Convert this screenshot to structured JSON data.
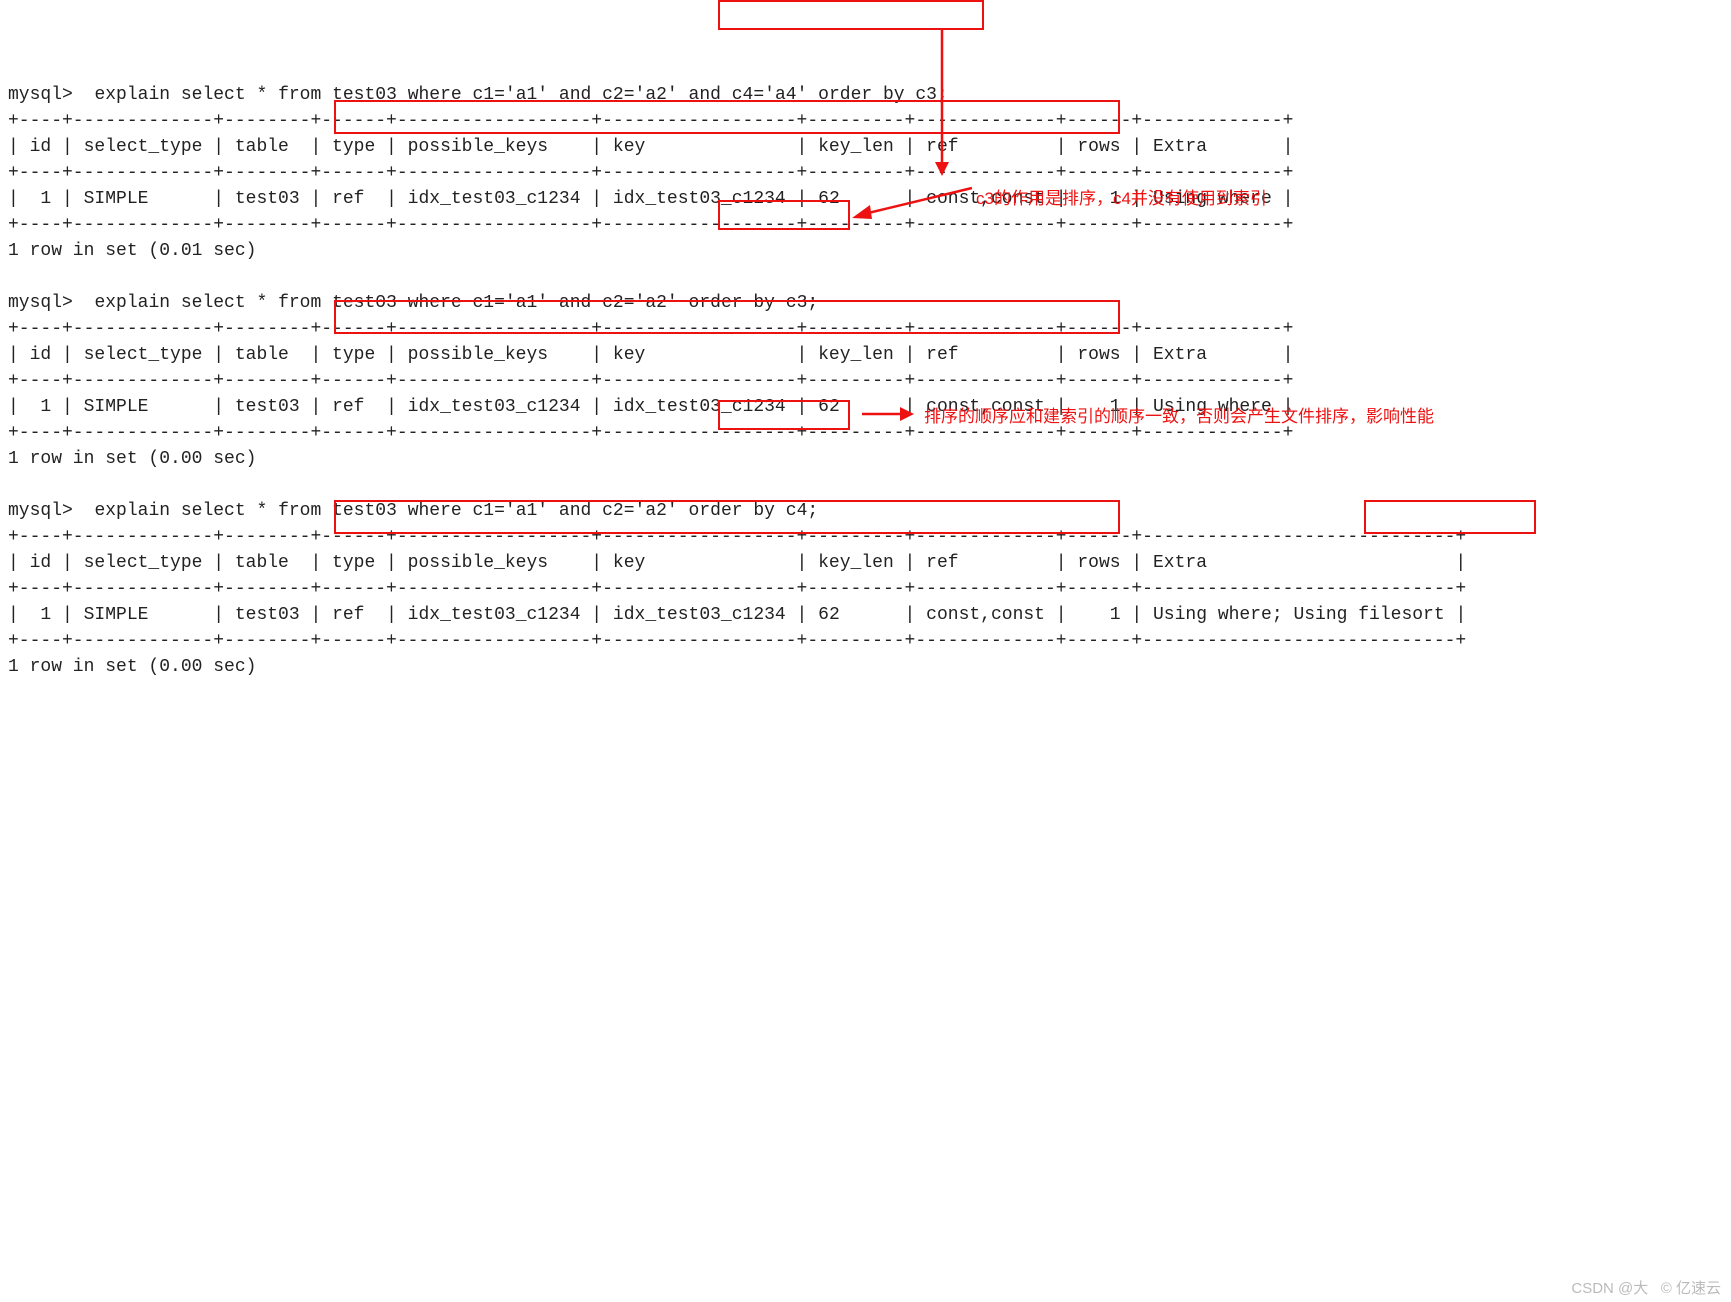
{
  "q1": {
    "prompt": "mysql> ",
    "sql_a": "explain select * from test03 where c1='a1' and c2='a2' ",
    "sql_box": "and c4='a4' order by c3",
    "sql_b": ";",
    "sep": "+----+-------------+--------+------+------------------+------------------+---------+-------------+------+-------------+",
    "hdr": "| id | select_type | table  | type | possible_keys    | key              | key_len | ref         | rows | Extra       |",
    "row_a": "|  1 | SIMPLE      | test03 | ",
    "row_box": "ref  | idx_test03_c1234 | idx_test03_c1234 | 62      | const,const",
    "row_b": " |    1 | Using where |",
    "foot": "1 row in set (0.01 sec)"
  },
  "q2": {
    "prompt": "mysql> ",
    "sql_a": "explain select * from test03 where c1='a1' and c2='a2' ",
    "sql_box": "order by c3",
    "sql_b": ";",
    "sep": "+----+-------------+--------+------+------------------+------------------+---------+-------------+------+-------------+",
    "hdr": "| id | select_type | table  | type | possible_keys    | key              | key_len | ref         | rows | Extra       |",
    "row_a": "|  1 | SIMPLE      | test03 | ",
    "row_box": "ref  | idx_test03_c1234 | idx_test03_c1234 | 62      | const,const",
    "row_b": " |    1 | Using where |",
    "foot": "1 row in set (0.00 sec)"
  },
  "q3": {
    "prompt": "mysql> ",
    "sql_a": "explain select * from test03 where c1='a1' and c2='a2' ",
    "sql_box": "order by c4",
    "sql_b": ";",
    "sep": "+----+-------------+--------+------+------------------+------------------+---------+-------------+------+-----------------------------+",
    "hdr": "| id | select_type | table  | type | possible_keys    | key              | key_len | ref         | rows | Extra                       |",
    "row_a": "|  1 | SIMPLE      | test03 | ",
    "row_box": "ref  | idx_test03_c1234 | idx_test03_c1234 | 62      | const,const",
    "row_b": " |    1 | Using where; ",
    "row_box2": "Using filesort",
    "row_c": " |",
    "foot": "1 row in set (0.00 sec)"
  },
  "annotations": {
    "a1": "c3的作用是排序，c4并没有使用到索引",
    "a2": "排序的顺序应和建索引的顺序一致，否则会产生文件排序，影响性能"
  },
  "watermark": "CSDN @大   © 亿速云",
  "colors": {
    "highlight": "#e11"
  }
}
